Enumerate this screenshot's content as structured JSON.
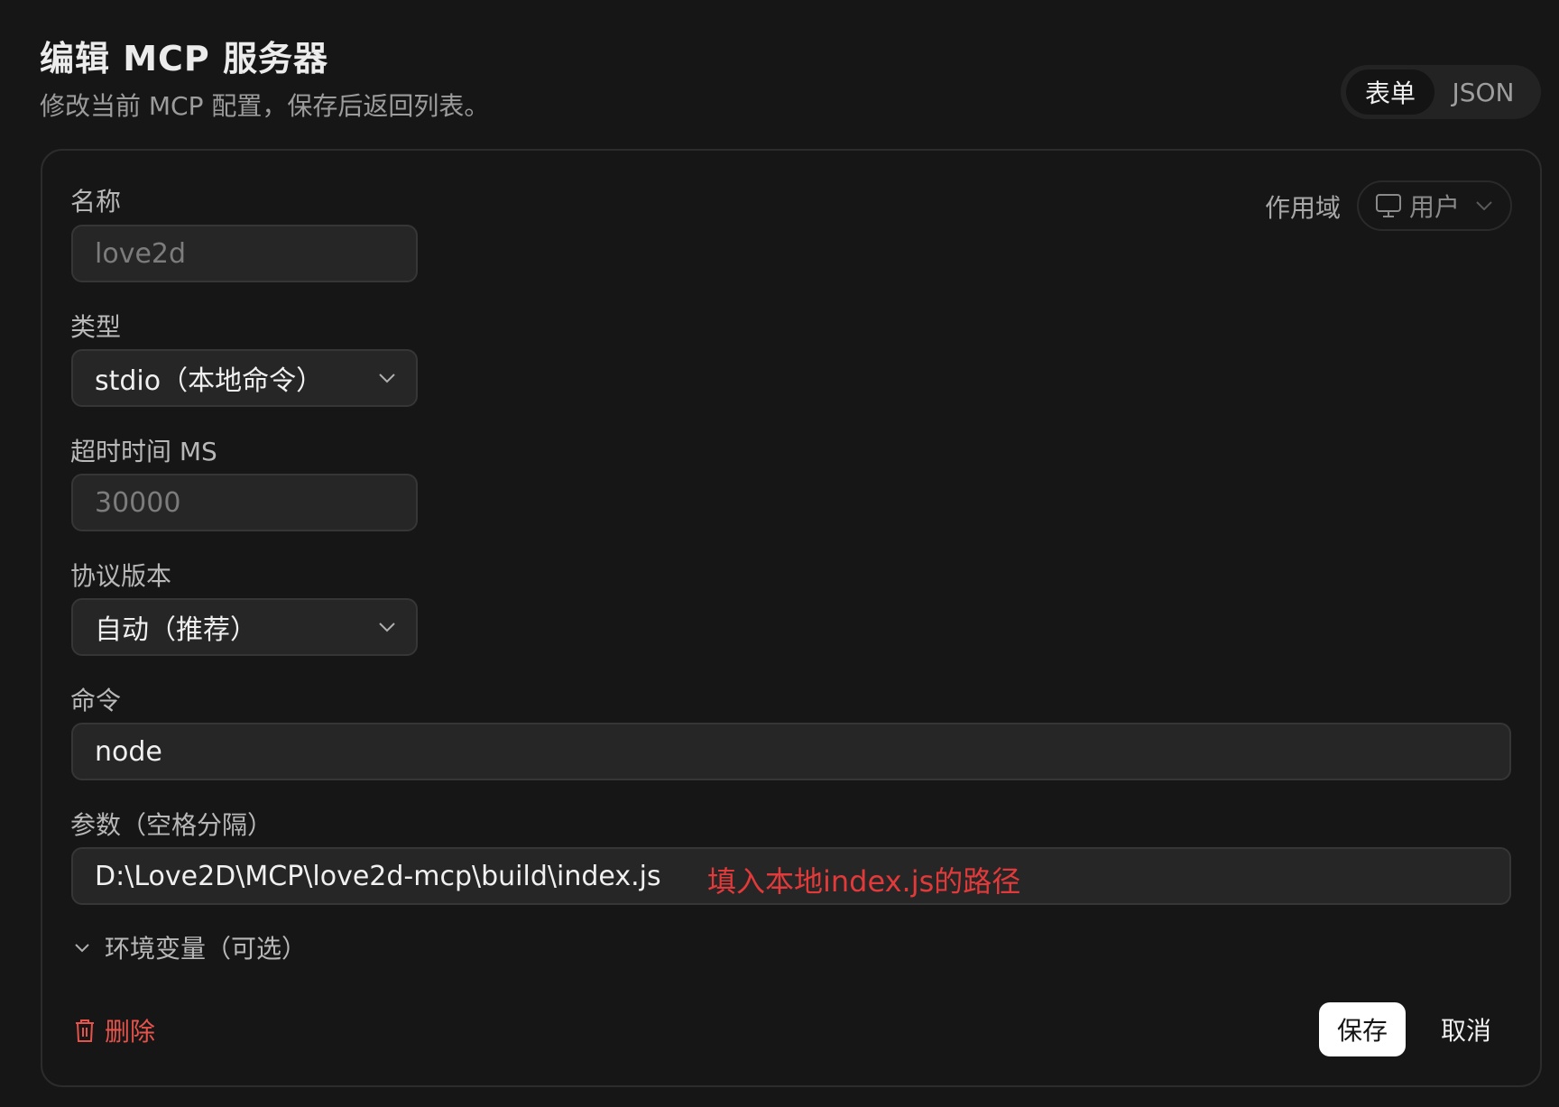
{
  "header": {
    "title": "编辑 MCP 服务器",
    "subtitle": "修改当前 MCP 配置，保存后返回列表。"
  },
  "mode_toggle": {
    "options": [
      "表单",
      "JSON"
    ],
    "selected": "表单"
  },
  "scope": {
    "label": "作用域",
    "value": "用户",
    "icon": "monitor-icon"
  },
  "form": {
    "name": {
      "label": "名称",
      "placeholder": "love2d"
    },
    "type": {
      "label": "类型",
      "value": "stdio（本地命令）"
    },
    "timeout": {
      "label": "超时时间 MS",
      "placeholder": "30000"
    },
    "protocol": {
      "label": "协议版本",
      "value": "自动（推荐）"
    },
    "command": {
      "label": "命令",
      "value": "node"
    },
    "args": {
      "label": "参数（空格分隔）",
      "value": "D:\\Love2D\\MCP\\love2d-mcp\\build\\index.js",
      "annotation": "填入本地index.js的路径"
    },
    "env": {
      "label": "环境变量（可选）",
      "expanded": false
    }
  },
  "actions": {
    "delete_label": "删除",
    "save_label": "保存",
    "cancel_label": "取消"
  },
  "colors": {
    "background": "#161616",
    "annotation": "#e23a3a",
    "danger": "#e5534b",
    "primary_button": "#ffffff"
  }
}
